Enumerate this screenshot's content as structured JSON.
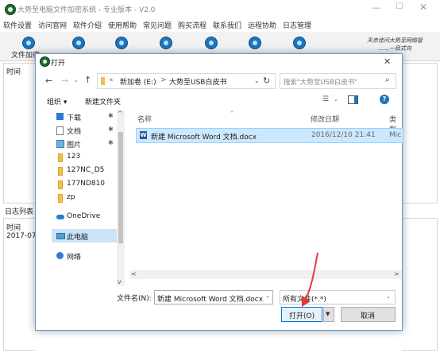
{
  "app": {
    "title": "大势至电脑文件加密系统 - 专业版本 - V2.0",
    "window_controls": {
      "minimize": "—",
      "maximize": "☐",
      "close": "✕"
    },
    "menu": [
      "软件设置",
      "访问官网",
      "软件介绍",
      "使用帮助",
      "常见问题",
      "购买流程",
      "联系我们",
      "远程协助",
      "日志管理"
    ],
    "toolbar": [
      "文件加密"
    ],
    "brand_script": [
      "天赤佳问大势至网络管",
      "……一目式向"
    ],
    "time_column_label": "时间",
    "log_section_label": "日志列表",
    "log_header_time": "时间",
    "log_first_date": "2017-07"
  },
  "dialog": {
    "title": "打开",
    "close_glyph": "✕",
    "nav": {
      "back": "←",
      "forward": "→",
      "dropdown": "⌄",
      "up": "↑",
      "refresh": "↻"
    },
    "address": {
      "separator": "«",
      "parts": [
        "新加卷 (E:)",
        "大势至USB白皮书"
      ],
      "chevron": ">"
    },
    "search_placeholder": "搜索\"大势至USB白皮书\"",
    "search_icon": "⌕",
    "commands": {
      "organize": "组织 ▾",
      "new_folder": "新建文件夹"
    },
    "view_icon": "☰",
    "help_glyph": "?",
    "nav_pane": [
      {
        "label": "下载",
        "icon": "download-arrow-icon",
        "pinned": true
      },
      {
        "label": "文档",
        "icon": "document-icon",
        "pinned": true
      },
      {
        "label": "图片",
        "icon": "picture-icon",
        "pinned": true
      },
      {
        "label": "123",
        "icon": "folder-icon",
        "pinned": false
      },
      {
        "label": "127NC_D5",
        "icon": "folder-icon",
        "pinned": false
      },
      {
        "label": "177ND810",
        "icon": "folder-icon",
        "pinned": false
      },
      {
        "label": "zp",
        "icon": "folder-icon",
        "pinned": false
      },
      {
        "label": "OneDrive",
        "icon": "cloud-icon",
        "pinned": false
      },
      {
        "label": "此电脑",
        "icon": "computer-icon",
        "pinned": false,
        "selected": true
      },
      {
        "label": "网络",
        "icon": "network-icon",
        "pinned": false
      }
    ],
    "pin_glyph": "✱",
    "columns": {
      "name": "名称",
      "date": "修改日期",
      "type": "类型",
      "sort_glyph": "^"
    },
    "files": [
      {
        "name": "新建 Microsoft Word 文档.docx",
        "date": "2016/12/10 21:41",
        "type": "Mic"
      }
    ],
    "scroll": {
      "up": "^",
      "down": "v",
      "left": "<",
      "right": ">"
    },
    "filename_label": "文件名(N):",
    "filename_value": "新建 Microsoft Word 文档.docx",
    "filetype_value": "所有文件(*.*)",
    "open_button": "打开(O)",
    "open_dropdown": "▼",
    "cancel_button": "取消"
  },
  "colors": {
    "accent_blue": "#0078d7",
    "selection": "#cce8ff",
    "annotation_arrow": "#e53935"
  }
}
